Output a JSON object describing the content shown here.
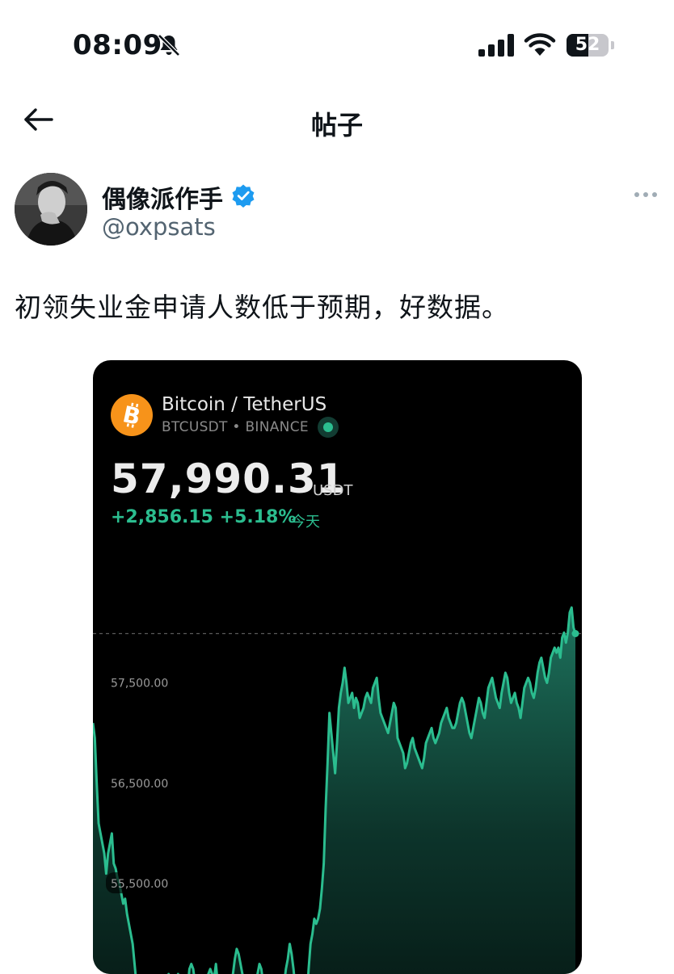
{
  "status_bar": {
    "time": "08:09",
    "battery": "52",
    "battery_level": 0.52
  },
  "nav": {
    "title": "帖子"
  },
  "author": {
    "name": "偶像派作手",
    "handle": "@oxpsats"
  },
  "post": {
    "text": "初领失业金申请人数低于预期，好数据。"
  },
  "card": {
    "pair": "Bitcoin / TetherUS",
    "meta": "BTCUSDT • BINANCE",
    "price": "57,990.31",
    "unit": "USDT",
    "change": "+2,856.15 +5.18%",
    "period": "今天",
    "colors": {
      "up": "#2bbd8f",
      "coin": "#f7931a"
    }
  },
  "chart_data": {
    "type": "area",
    "y_ticks": [
      "57,500.00",
      "56,500.00",
      "55,500.00"
    ],
    "y_tick_values": [
      57500,
      56500,
      55500
    ],
    "ylim": [
      54600,
      58300
    ],
    "reference_line": 57990.31,
    "values": [
      57100,
      56950,
      56500,
      56100,
      56000,
      55900,
      55800,
      55600,
      55800,
      55900,
      56000,
      55700,
      55650,
      55550,
      55500,
      55400,
      55300,
      55350,
      55200,
      55100,
      55000,
      54900,
      54700,
      54500,
      54350,
      54250,
      54200,
      54150,
      54150,
      54300,
      54400,
      54350,
      54300,
      54250,
      54200,
      54250,
      54300,
      54400,
      54450,
      54550,
      54600,
      54500,
      54400,
      54450,
      54500,
      54600,
      54550,
      54500,
      54450,
      54400,
      54450,
      54650,
      54700,
      54650,
      54500,
      54400,
      54450,
      54450,
      54400,
      54500,
      54550,
      54600,
      54650,
      54600,
      54550,
      54700,
      54500,
      54500,
      54400,
      54350,
      54300,
      54250,
      54450,
      54550,
      54600,
      54750,
      54850,
      54800,
      54700,
      54600,
      54400,
      54350,
      54250,
      54300,
      54350,
      54400,
      54500,
      54600,
      54700,
      54650,
      54500,
      54300,
      54250,
      54300,
      54500,
      54550,
      54450,
      54400,
      54400,
      54350,
      54450,
      54500,
      54650,
      54750,
      54900,
      54800,
      54650,
      54450,
      54500,
      54550,
      54500,
      54400,
      54300,
      54350,
      54650,
      54900,
      55000,
      55150,
      55100,
      55150,
      55250,
      55450,
      55700,
      56250,
      56700,
      57200,
      57000,
      56800,
      56600,
      56900,
      57250,
      57400,
      57500,
      57650,
      57500,
      57300,
      57350,
      57400,
      57250,
      57350,
      57300,
      57150,
      57200,
      57250,
      57350,
      57400,
      57350,
      57300,
      57450,
      57500,
      57550,
      57350,
      57200,
      57150,
      57100,
      57050,
      57000,
      57100,
      57200,
      57300,
      57250,
      56950,
      56900,
      56850,
      56800,
      56650,
      56700,
      56800,
      56900,
      56950,
      56850,
      56800,
      56750,
      56700,
      56650,
      56750,
      56900,
      56950,
      57000,
      57050,
      56950,
      56900,
      56950,
      57000,
      57100,
      57150,
      57200,
      57250,
      57150,
      57100,
      57050,
      57050,
      57100,
      57200,
      57300,
      57350,
      57300,
      57200,
      57100,
      57000,
      56950,
      57050,
      57150,
      57250,
      57350,
      57300,
      57200,
      57150,
      57300,
      57450,
      57500,
      57550,
      57450,
      57350,
      57300,
      57250,
      57400,
      57500,
      57600,
      57550,
      57400,
      57300,
      57350,
      57400,
      57300,
      57250,
      57150,
      57300,
      57450,
      57500,
      57550,
      57500,
      57400,
      57350,
      57450,
      57600,
      57700,
      57750,
      57650,
      57550,
      57500,
      57600,
      57750,
      57800,
      57850,
      57800,
      57850,
      57750,
      57950,
      58000,
      57900,
      58000,
      58200,
      58250,
      58050,
      57990
    ]
  }
}
